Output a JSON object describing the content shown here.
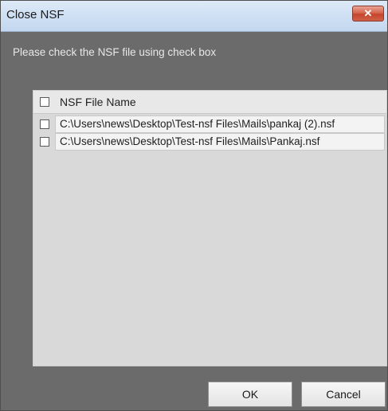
{
  "window": {
    "title": "Close NSF",
    "close_symbol": "✕"
  },
  "instruction": "Please check the NSF file using check box",
  "list": {
    "header": "NSF File Name",
    "rows": [
      {
        "path": "C:\\Users\\news\\Desktop\\Test-nsf Files\\Mails\\pankaj (2).nsf",
        "checked": false
      },
      {
        "path": "C:\\Users\\news\\Desktop\\Test-nsf Files\\Mails\\Pankaj.nsf",
        "checked": false
      }
    ]
  },
  "buttons": {
    "ok": "OK",
    "cancel": "Cancel"
  }
}
